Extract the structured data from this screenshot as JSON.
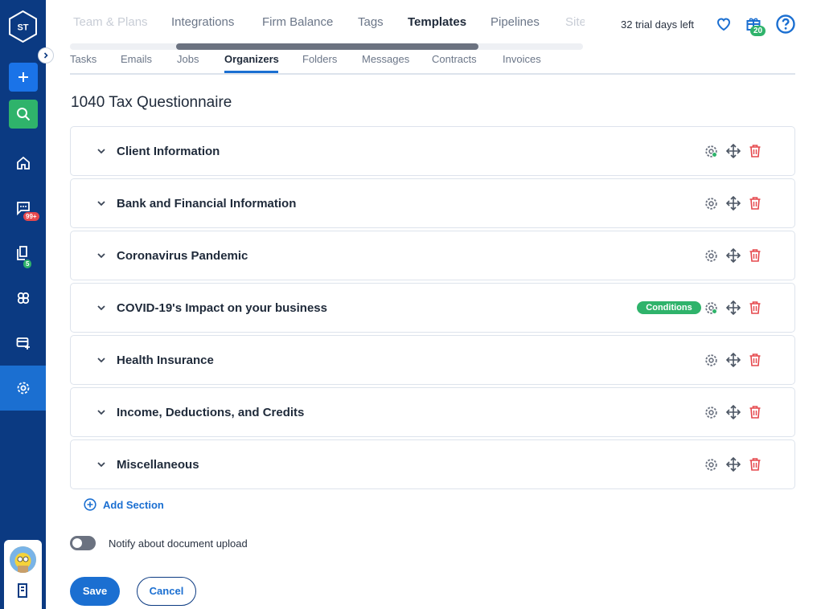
{
  "sidebar": {
    "logo_text": "ST",
    "badges": {
      "messages": "99+",
      "documents": "5"
    }
  },
  "top_nav": {
    "tabs": [
      "Team & Plans",
      "Integrations",
      "Firm Balance",
      "Tags",
      "Templates",
      "Pipelines",
      "Site"
    ],
    "active_tab": "Templates",
    "trial_text": "32 trial days left",
    "gift_count": "20"
  },
  "sub_nav": {
    "tabs": [
      "Tasks",
      "Emails",
      "Jobs",
      "Organizers",
      "Folders",
      "Messages",
      "Contracts",
      "Invoices"
    ],
    "active_tab": "Organizers"
  },
  "page": {
    "title": "1040 Tax Questionnaire",
    "sections": [
      {
        "title": "Client Information",
        "gear_active": true,
        "conditions": ""
      },
      {
        "title": "Bank and Financial Information",
        "gear_active": false,
        "conditions": ""
      },
      {
        "title": "Coronavirus Pandemic",
        "gear_active": false,
        "conditions": ""
      },
      {
        "title": "COVID-19's Impact on your business",
        "gear_active": true,
        "conditions": "Conditions"
      },
      {
        "title": "Health Insurance",
        "gear_active": false,
        "conditions": ""
      },
      {
        "title": "Income, Deductions, and Credits",
        "gear_active": false,
        "conditions": ""
      },
      {
        "title": "Miscellaneous",
        "gear_active": false,
        "conditions": ""
      }
    ],
    "add_section_label": "Add Section",
    "notify_label": "Notify about document upload",
    "notify_enabled": false,
    "save_label": "Save",
    "cancel_label": "Cancel"
  },
  "colors": {
    "sidebar": "#0b3a82",
    "primary": "#1b6fd1",
    "success": "#2fb36b",
    "danger": "#e5484d"
  }
}
